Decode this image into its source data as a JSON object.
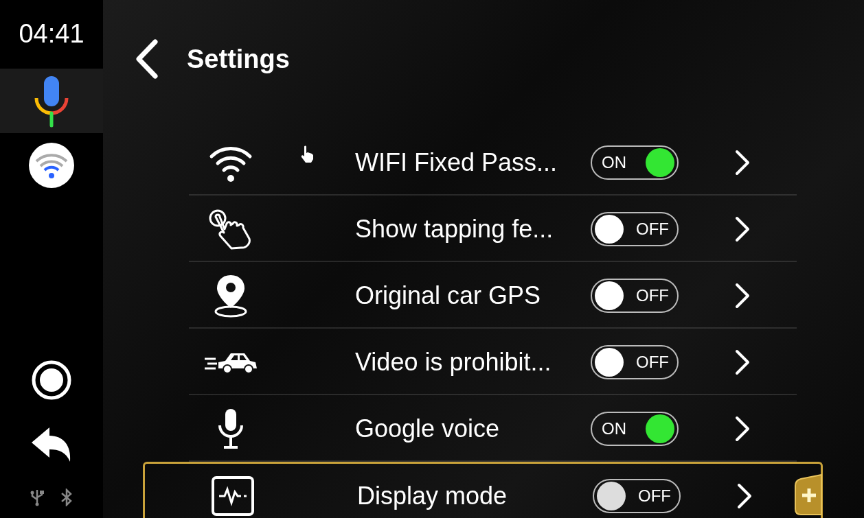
{
  "status": {
    "time": "04:41"
  },
  "sidebar": {
    "items": [
      {
        "kind": "mic",
        "selected": true
      },
      {
        "kind": "wifi",
        "selected": false
      },
      {
        "kind": "home",
        "selected": false
      },
      {
        "kind": "back",
        "selected": false
      }
    ]
  },
  "header": {
    "title": "Settings"
  },
  "settings": [
    {
      "label": "WIFI Fixed Pass...",
      "on": true,
      "toggle_text": "ON",
      "selected": false
    },
    {
      "label": "Show tapping fe...",
      "on": false,
      "toggle_text": "OFF",
      "selected": false
    },
    {
      "label": "Original car GPS",
      "on": false,
      "toggle_text": "OFF",
      "selected": false
    },
    {
      "label": "Video is prohibit...",
      "on": false,
      "toggle_text": "OFF",
      "selected": false
    },
    {
      "label": "Google voice",
      "on": true,
      "toggle_text": "ON",
      "selected": false
    },
    {
      "label": "Display mode",
      "on": false,
      "toggle_text": "OFF",
      "selected": true
    }
  ]
}
